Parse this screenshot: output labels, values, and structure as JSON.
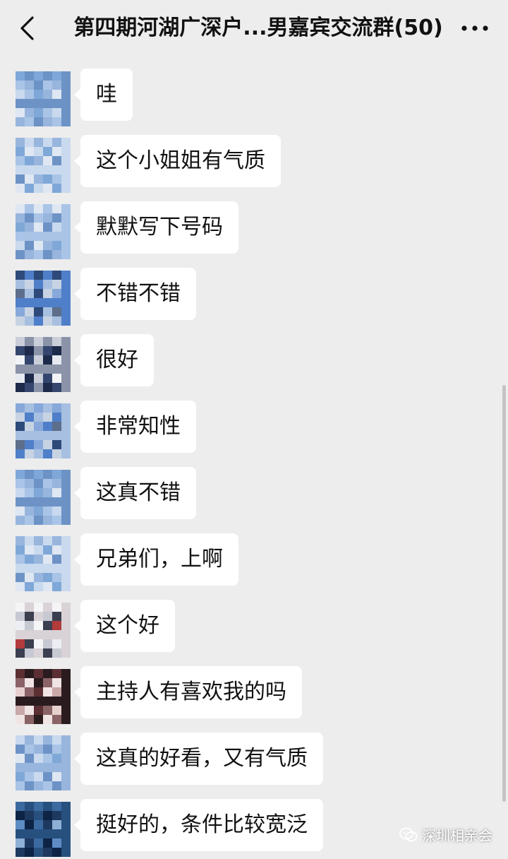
{
  "header": {
    "title": "第四期河湖广深户...男嘉宾交流群(50)",
    "back_icon": "chevron-left-icon",
    "more_icon": "more-dots-icon"
  },
  "messages": [
    {
      "text": "哇",
      "avatar": "blue"
    },
    {
      "text": "这个小姐姐有气质",
      "avatar": "blue"
    },
    {
      "text": "默默写下号码",
      "avatar": "blue"
    },
    {
      "text": "不错不错",
      "avatar": "sky"
    },
    {
      "text": "很好",
      "avatar": "person"
    },
    {
      "text": "非常知性",
      "avatar": "sky"
    },
    {
      "text": "这真不错",
      "avatar": "blue"
    },
    {
      "text": "兄弟们，上啊",
      "avatar": "blue"
    },
    {
      "text": "这个好",
      "avatar": "light"
    },
    {
      "text": "主持人有喜欢我的吗",
      "avatar": "dark"
    },
    {
      "text": "这真的好看，又有气质",
      "avatar": "blue"
    },
    {
      "text": "挺好的，条件比较宽泛",
      "avatar": "navy"
    }
  ],
  "watermark": {
    "text": "深圳相亲会",
    "icon": "wechat-icon"
  },
  "colors": {
    "background": "#ededed",
    "bubble": "#ffffff",
    "text": "#111111"
  }
}
